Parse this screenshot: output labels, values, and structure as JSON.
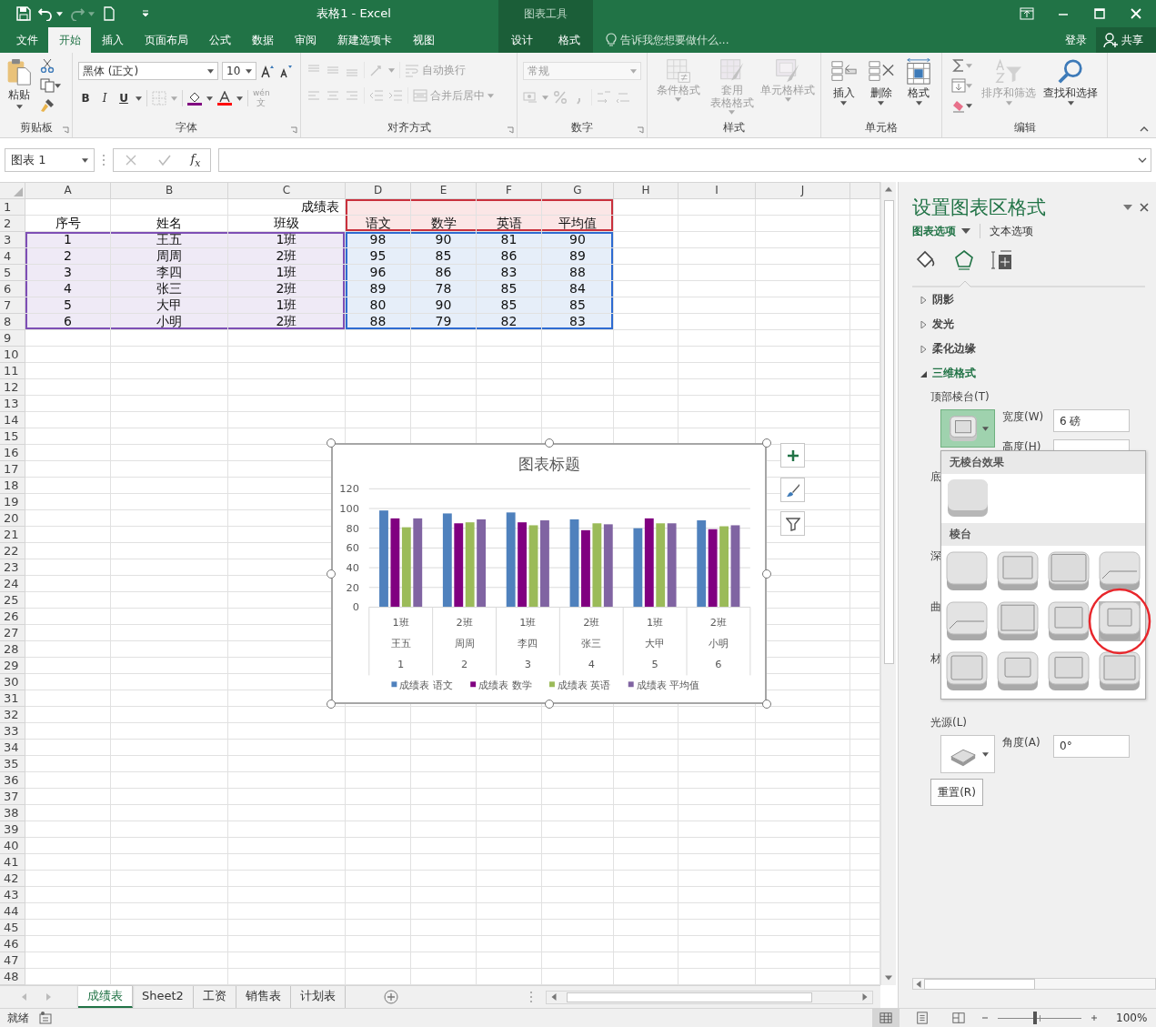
{
  "title_bar": {
    "title": "表格1 - Excel",
    "context_label": "图表工具",
    "redo_disabled": true
  },
  "menu_tabs": [
    {
      "label": "文件",
      "selected": false,
      "kind": "normal"
    },
    {
      "label": "开始",
      "selected": true,
      "kind": "normal"
    },
    {
      "label": "插入",
      "selected": false,
      "kind": "normal"
    },
    {
      "label": "页面布局",
      "selected": false,
      "kind": "normal"
    },
    {
      "label": "公式",
      "selected": false,
      "kind": "normal"
    },
    {
      "label": "数据",
      "selected": false,
      "kind": "normal"
    },
    {
      "label": "审阅",
      "selected": false,
      "kind": "normal"
    },
    {
      "label": "新建选项卡",
      "selected": false,
      "kind": "normal"
    },
    {
      "label": "视图",
      "selected": false,
      "kind": "normal"
    },
    {
      "label": "设计",
      "selected": false,
      "kind": "context"
    },
    {
      "label": "格式",
      "selected": false,
      "kind": "context"
    }
  ],
  "tell_me": {
    "placeholder": "告诉我您想要做什么..."
  },
  "sign_in": "登录",
  "share": "共享",
  "ribbon": {
    "clipboard": {
      "label": "剪贴板",
      "paste": "粘贴"
    },
    "font": {
      "label": "字体",
      "font_name": "黑体 (正文)",
      "font_size": "10",
      "bold": "B",
      "italic": "I",
      "underline": "U",
      "phonetic_top": "wén",
      "phonetic_bottom": "文",
      "phonetic_disabled": true
    },
    "alignment": {
      "label": "对齐方式",
      "wrap": "自动换行",
      "merge": "合并后居中",
      "disabled": true
    },
    "number": {
      "label": "数字",
      "format": "常规",
      "disabled": true
    },
    "styles": {
      "label": "样式",
      "buttons": [
        {
          "kind": "conditional",
          "lines": [
            "条件格式"
          ],
          "disabled": true
        },
        {
          "kind": "table",
          "lines": [
            "套用",
            "表格格式"
          ],
          "disabled": true
        },
        {
          "kind": "cellstyle",
          "lines": [
            "单元格样式"
          ],
          "disabled": true
        }
      ]
    },
    "cells": {
      "label": "单元格",
      "buttons": [
        {
          "kind": "insert",
          "label": "插入",
          "disabled": false
        },
        {
          "kind": "delete",
          "label": "删除",
          "disabled": false
        },
        {
          "kind": "format",
          "label": "格式",
          "disabled": false
        }
      ]
    },
    "editing": {
      "label": "编辑",
      "sort": {
        "label": "排序和筛选",
        "disabled": true
      },
      "find": {
        "label": "查找和选择",
        "disabled": false
      }
    }
  },
  "formula_bar": {
    "name_box": "图表 1",
    "function_symbol": "f$_{x}$"
  },
  "sheet": {
    "columns": [
      "A",
      "B",
      "C",
      "D",
      "E",
      "F",
      "G",
      "H",
      "I",
      "J"
    ],
    "row_numbers": [
      "1",
      "2",
      "3",
      "4",
      "5",
      "6",
      "7",
      "8",
      "9",
      "10",
      "11",
      "12",
      "13",
      "14",
      "15",
      "16",
      "17",
      "18",
      "19",
      "20",
      "21",
      "22",
      "23",
      "24",
      "25",
      "26",
      "27",
      "28",
      "29",
      "30",
      "31",
      "32",
      "33",
      "34",
      "35",
      "36",
      "37",
      "38",
      "39",
      "40",
      "41",
      "42",
      "43",
      "44",
      "45",
      "46",
      "47",
      "48"
    ],
    "cells": [
      [
        {},
        {},
        {
          "text": "成绩表",
          "kind": "title"
        },
        {
          "kind": "series"
        },
        {
          "kind": "series"
        },
        {
          "kind": "series"
        },
        {
          "kind": "series"
        }
      ],
      [
        {
          "text": "序号"
        },
        {
          "text": "姓名"
        },
        {
          "text": "班级"
        },
        {
          "text": "语文",
          "kind": "series"
        },
        {
          "text": "数学",
          "kind": "series"
        },
        {
          "text": "英语",
          "kind": "series"
        },
        {
          "text": "平均值",
          "kind": "series"
        }
      ],
      [
        {
          "text": "1",
          "kind": "category"
        },
        {
          "text": "王五",
          "kind": "category"
        },
        {
          "text": "1班",
          "kind": "category"
        },
        {
          "text": "98",
          "kind": "values"
        },
        {
          "text": "90",
          "kind": "values"
        },
        {
          "text": "81",
          "kind": "values"
        },
        {
          "text": "90",
          "kind": "values"
        }
      ],
      [
        {
          "text": "2",
          "kind": "category"
        },
        {
          "text": "周周",
          "kind": "category"
        },
        {
          "text": "2班",
          "kind": "category"
        },
        {
          "text": "95",
          "kind": "values"
        },
        {
          "text": "85",
          "kind": "values"
        },
        {
          "text": "86",
          "kind": "values"
        },
        {
          "text": "89",
          "kind": "values"
        }
      ],
      [
        {
          "text": "3",
          "kind": "category"
        },
        {
          "text": "李四",
          "kind": "category"
        },
        {
          "text": "1班",
          "kind": "category"
        },
        {
          "text": "96",
          "kind": "values"
        },
        {
          "text": "86",
          "kind": "values"
        },
        {
          "text": "83",
          "kind": "values"
        },
        {
          "text": "88",
          "kind": "values"
        }
      ],
      [
        {
          "text": "4",
          "kind": "category"
        },
        {
          "text": "张三",
          "kind": "category"
        },
        {
          "text": "2班",
          "kind": "category"
        },
        {
          "text": "89",
          "kind": "values"
        },
        {
          "text": "78",
          "kind": "values"
        },
        {
          "text": "85",
          "kind": "values"
        },
        {
          "text": "84",
          "kind": "values"
        }
      ],
      [
        {
          "text": "5",
          "kind": "category"
        },
        {
          "text": "大甲",
          "kind": "category"
        },
        {
          "text": "1班",
          "kind": "category"
        },
        {
          "text": "80",
          "kind": "values"
        },
        {
          "text": "90",
          "kind": "values"
        },
        {
          "text": "85",
          "kind": "values"
        },
        {
          "text": "85",
          "kind": "values"
        }
      ],
      [
        {
          "text": "6",
          "kind": "category"
        },
        {
          "text": "小明",
          "kind": "category"
        },
        {
          "text": "2班",
          "kind": "category"
        },
        {
          "text": "88",
          "kind": "values"
        },
        {
          "text": "79",
          "kind": "values"
        },
        {
          "text": "82",
          "kind": "values"
        },
        {
          "text": "83",
          "kind": "values"
        }
      ]
    ]
  },
  "chart": {
    "chart_data": {
      "type": "bar",
      "title": "图表标题",
      "categories": [
        "1",
        "2",
        "3",
        "4",
        "5",
        "6"
      ],
      "series": [
        {
          "name": "成绩表 语文",
          "color": "#4f81bd",
          "values": [
            98,
            95,
            96,
            89,
            80,
            88
          ]
        },
        {
          "name": "成绩表 数学",
          "color": "#800080",
          "values": [
            90,
            85,
            86,
            78,
            90,
            79
          ]
        },
        {
          "name": "成绩表 英语",
          "color": "#9bbb59",
          "values": [
            81,
            86,
            83,
            85,
            85,
            82
          ]
        },
        {
          "name": "成绩表 平均值",
          "color": "#8064a2",
          "values": [
            90,
            89,
            88,
            84,
            85,
            83
          ]
        }
      ],
      "ylim": [
        0,
        120
      ],
      "yticks": [
        0,
        20,
        40,
        60,
        80,
        100,
        120
      ],
      "grid": true,
      "legend": "bottom"
    },
    "category_groups": [
      {
        "class": "1班",
        "name": "王五"
      },
      {
        "class": "2班",
        "name": "周周"
      },
      {
        "class": "1班",
        "name": "李四"
      },
      {
        "class": "2班",
        "name": "张三"
      },
      {
        "class": "1班",
        "name": "大甲"
      },
      {
        "class": "2班",
        "name": "小明"
      }
    ]
  },
  "format_pane": {
    "title": "设置图表区格式",
    "tabs": [
      {
        "label": "图表选项",
        "selected": true
      },
      {
        "label": "文本选项",
        "selected": false
      }
    ],
    "icon_tabs": [
      {
        "kind": "fill",
        "selected": false
      },
      {
        "kind": "effects",
        "selected": true
      },
      {
        "kind": "size",
        "selected": false
      }
    ],
    "sections": [
      {
        "label": "阴影",
        "expanded": false
      },
      {
        "label": "发光",
        "expanded": false
      },
      {
        "label": "柔化边缘",
        "expanded": false
      },
      {
        "label": "三维格式",
        "expanded": true
      }
    ],
    "top_bevel_label": "顶部棱台(T)",
    "width_label": "宽度(W)",
    "width": "6 磅",
    "height_label": "高度(H)",
    "covered_labels": [
      "底",
      "深",
      "曲",
      "材"
    ],
    "light_label": "光源(L)",
    "angle_label": "角度(A)",
    "angle": "0°",
    "reset": "重置(R)",
    "gallery": {
      "none_header": "无棱台效果",
      "bevel_header": "棱台",
      "none_selected": false,
      "tiles": [
        {
          "kind": "circle",
          "selected": false
        },
        {
          "kind": "inset",
          "selected": false
        },
        {
          "kind": "cross",
          "selected": false
        },
        {
          "kind": "slant",
          "selected": false
        },
        {
          "kind": "angle",
          "selected": false
        },
        {
          "kind": "softround",
          "selected": false
        },
        {
          "kind": "convex",
          "selected": false
        },
        {
          "kind": "slope",
          "selected": true
        },
        {
          "kind": "divot",
          "selected": false
        },
        {
          "kind": "riblet",
          "selected": false
        },
        {
          "kind": "hardedge",
          "selected": false
        },
        {
          "kind": "artdeco",
          "selected": false
        }
      ]
    }
  },
  "sheet_tabs": [
    {
      "label": "成绩表",
      "selected": true
    },
    {
      "label": "Sheet2",
      "selected": false
    },
    {
      "label": "工资",
      "selected": false
    },
    {
      "label": "销售表",
      "selected": false
    },
    {
      "label": "计划表",
      "selected": false
    }
  ],
  "status_bar": {
    "ready": "就绪",
    "views": [
      {
        "kind": "normal",
        "selected": true
      },
      {
        "kind": "pagelayout",
        "selected": false
      },
      {
        "kind": "pagebreak",
        "selected": false
      }
    ],
    "zoom": {
      "level": 0.45,
      "reading": "100%"
    }
  }
}
